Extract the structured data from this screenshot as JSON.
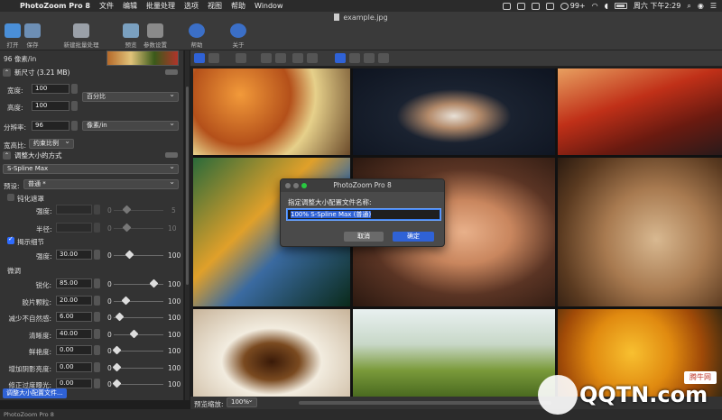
{
  "menubar": {
    "app_name": "PhotoZoom Pro 8",
    "items": [
      "文件",
      "编辑",
      "批量处理",
      "选项",
      "视图",
      "帮助",
      "Window"
    ],
    "notification_count": "99+",
    "clock": "周六 下午2:29"
  },
  "window": {
    "title": "example.jpg"
  },
  "toolbar": {
    "buttons": [
      {
        "label": "打开",
        "icon": "folder-icon"
      },
      {
        "label": "保存",
        "icon": "save-icon"
      },
      {
        "label": "新建批量处理",
        "icon": "batch-icon"
      },
      {
        "label": "预览",
        "icon": "preview-icon"
      },
      {
        "label": "参数设置",
        "icon": "settings-icon"
      },
      {
        "label": "帮助",
        "icon": "help-icon"
      },
      {
        "label": "关于",
        "icon": "info-icon"
      }
    ]
  },
  "left_panel": {
    "dpi_label": "96 像素/in",
    "new_size": {
      "header": "新尺寸 (3.21 MB)",
      "width_label": "宽度:",
      "width_value": "100",
      "height_label": "高度:",
      "height_value": "100",
      "unit_select": "百分比",
      "resolution_label": "分辨率:",
      "resolution_value": "96",
      "resolution_unit": "像素/in",
      "aspect_label": "宽高比:",
      "aspect_select": "约束比例"
    },
    "resize_method": {
      "header": "调整大小的方式",
      "method_select": "S-Spline Max",
      "preset_label": "预设:",
      "preset_select": "普通 *",
      "sharpen_mask_label": "钝化遮罩",
      "sharpen_mask_checked": false,
      "strength_label": "强度:",
      "strength_min": "0",
      "strength_max": "5",
      "radius_label": "半径:",
      "radius_min": "0",
      "radius_max": "10",
      "refine_detail_label": "揭示细节",
      "refine_detail_checked": true,
      "refine_strength_label": "强度:",
      "refine_strength_value": "30.00",
      "refine_strength_min": "0",
      "refine_strength_max": "100",
      "fine_tune_label": "微调",
      "fine_tune": [
        {
          "label": "锐化:",
          "value": "85.00",
          "min": "0",
          "max": "100",
          "level": 0.85
        },
        {
          "label": "胶片颗粒:",
          "value": "20.00",
          "min": "0",
          "max": "100",
          "level": 0.2
        },
        {
          "label": "减少不自然感:",
          "value": "6.00",
          "min": "0",
          "max": "100",
          "level": 0.06
        },
        {
          "label": "清晰度:",
          "value": "40.00",
          "min": "0",
          "max": "100",
          "level": 0.4
        },
        {
          "label": "鲜艳度:",
          "value": "0.00",
          "min": "0",
          "max": "100",
          "level": 0.0
        },
        {
          "label": "增加阴影亮度:",
          "value": "0.00",
          "min": "0",
          "max": "100",
          "level": 0.0
        },
        {
          "label": "修正过度曝光:",
          "value": "0.00",
          "min": "0",
          "max": "100",
          "level": 0.0
        }
      ],
      "refine_strength_level": 0.3,
      "config_button": "调整大小配置文件..."
    }
  },
  "preview": {
    "zoom_label": "预览缩放:",
    "zoom_value": "100%"
  },
  "status_bar": {
    "text": "PhotoZoom Pro 8"
  },
  "dialog": {
    "title": "PhotoZoom Pro 8",
    "prompt": "指定调整大小配置文件名称:",
    "input_value": "100% S-Spline Max (普通)",
    "cancel_label": "取消",
    "ok_label": "确定"
  },
  "watermark": {
    "brand": "QQTN.com",
    "tag": "腾牛网"
  },
  "colors": {
    "accent": "#2f62d6",
    "panel": "#333333",
    "toolbar": "#3a3a3a"
  }
}
